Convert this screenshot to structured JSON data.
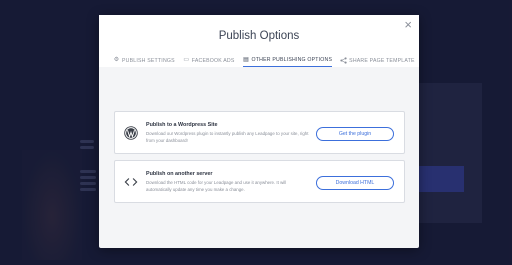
{
  "modal": {
    "title": "Publish Options",
    "close_icon": "close-icon"
  },
  "tabs": [
    {
      "label": "PUBLISH SETTINGS",
      "icon": "gear-icon",
      "glyph": "⚙",
      "active": false
    },
    {
      "label": "FACEBOOK ADS",
      "icon": "monitor-icon",
      "glyph": "▭",
      "active": false
    },
    {
      "label": "OTHER PUBLISHING OPTIONS",
      "icon": "calendar-icon",
      "glyph": "▤",
      "active": true
    },
    {
      "label": "SHARE PAGE TEMPLATE",
      "icon": "share-icon",
      "glyph": "<",
      "active": false
    }
  ],
  "options": [
    {
      "title": "Publish to a Wordpress Site",
      "description": "Download our Wordpress plugin to instantly publish any Leadpage to your site, right from your dashboard!",
      "button": "Get the plugin",
      "icon": "wordpress-icon"
    },
    {
      "title": "Publish on another server",
      "description": "Download the HTML code for your Leadpage and use it anywhere. It will automatically update any time you make a change.",
      "button": "Download HTML",
      "icon": "code-icon"
    }
  ],
  "colors": {
    "accent": "#3c6fdb",
    "background_page": "#262b52",
    "modal_bg": "#f4f5f7"
  }
}
